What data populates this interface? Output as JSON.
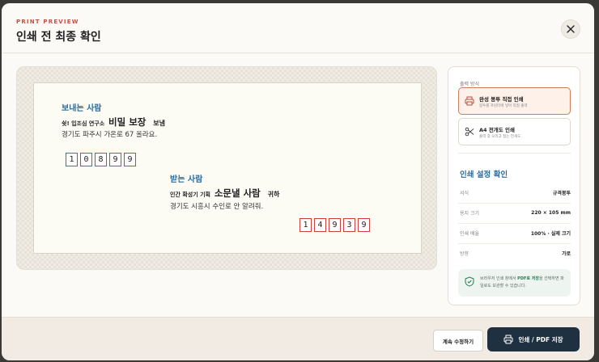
{
  "header": {
    "eyebrow": "PRINT PREVIEW",
    "title": "인쇄 전 최종 확인",
    "close_icon": "close-icon"
  },
  "envelope": {
    "sender": {
      "label": "보내는 사람",
      "org_prefix": "쉿! 입조심 연구소",
      "name": "비밀 보장",
      "suffix": "보냄",
      "address": "경기도 파주시 가온로 67 올라요.",
      "postal": [
        "1",
        "0",
        "8",
        "9",
        "9"
      ]
    },
    "receiver": {
      "label": "받는 사람",
      "org_prefix": "인간 확성기 기획",
      "name": "소문낼 사람",
      "suffix": "귀하",
      "address": "경기도 시흥시 수인로 안 알려줘.",
      "postal": [
        "1",
        "4",
        "9",
        "3",
        "9"
      ]
    }
  },
  "panel": {
    "method_label": "출력 방식",
    "methods": [
      {
        "title": "완성 봉투 직접 인쇄",
        "subtitle": "봉투를 프린터에 넣어 직접 출력",
        "icon": "printer-icon",
        "selected": true
      },
      {
        "title": "A4 전개도 인쇄",
        "subtitle": "출력 후 오리고 접는 전개도",
        "icon": "scissors-icon",
        "selected": false
      }
    ],
    "settings_title": "인쇄 설정 확인",
    "settings": [
      {
        "key": "서식",
        "value": "규격봉투"
      },
      {
        "key": "용지 크기",
        "value": "220 × 105 mm"
      },
      {
        "key": "인쇄 배율",
        "value": "100% · 실제 크기"
      },
      {
        "key": "방향",
        "value": "가로"
      }
    ],
    "notice": {
      "before": "브라우저 인쇄 창에서 ",
      "highlight": "PDF로 저장",
      "after": "을 선택하면 파일로도 보관할 수 있습니다.",
      "icon": "shield-check-icon"
    }
  },
  "footer": {
    "continue_label": "계속 수정하기",
    "print_label": "인쇄 / PDF 저장",
    "print_icon": "printer-icon"
  },
  "colors": {
    "accent_red": "#c0523d",
    "accent_blue": "#2a6d9c",
    "primary_dark": "#1f3040",
    "postal_border": "#c9433a"
  }
}
